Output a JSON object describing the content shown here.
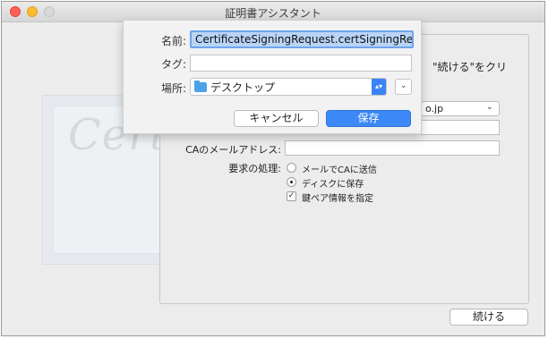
{
  "window": {
    "title": "証明書アシスタント"
  },
  "assistant": {
    "instruction": "\"続ける\"をクリ",
    "email_popup_value": "o.jp",
    "ca_email_label": "CAのメールアドレス:",
    "request_label": "要求の処理:",
    "option_email_ca": "メールでCAに送信",
    "option_save_disk": "ディスクに保存",
    "option_keypair": "鍵ペア情報を指定",
    "continue_label": "続ける"
  },
  "certificate": {
    "script_text": "Certi"
  },
  "save_sheet": {
    "name_label": "名前:",
    "name_value": "CertificateSigningRequest.certSigningRe",
    "tag_label": "タグ:",
    "location_label": "場所:",
    "location_value": "デスクトップ",
    "cancel_label": "キャンセル",
    "save_label": "保存"
  },
  "colors": {
    "accent": "#3b88f6",
    "name_highlight": "#b9d4f7"
  }
}
